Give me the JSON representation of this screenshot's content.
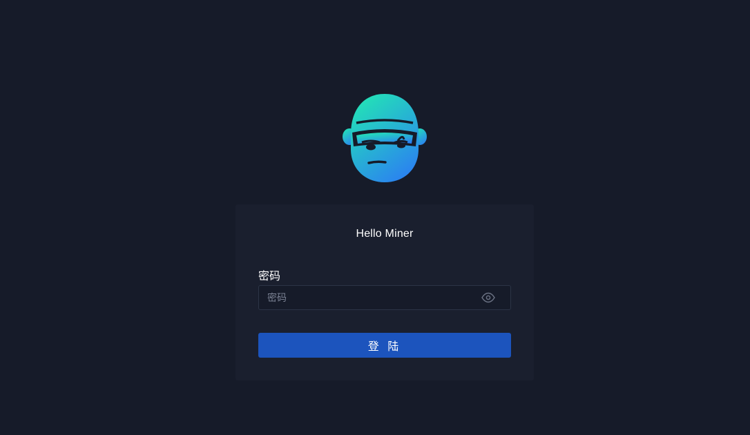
{
  "logo": {
    "icon": "miner-mascot-icon",
    "gradient": [
      "#25e0b8",
      "#2a86f0"
    ]
  },
  "card": {
    "title": "Hello Miner",
    "password_label": "密码",
    "password_placeholder": "密码",
    "password_value": "",
    "toggle_icon": "eye-icon",
    "login_label": "登 陆"
  },
  "colors": {
    "background": "#161b29",
    "card": "#1a1f2e",
    "primary": "#1c54bd"
  }
}
